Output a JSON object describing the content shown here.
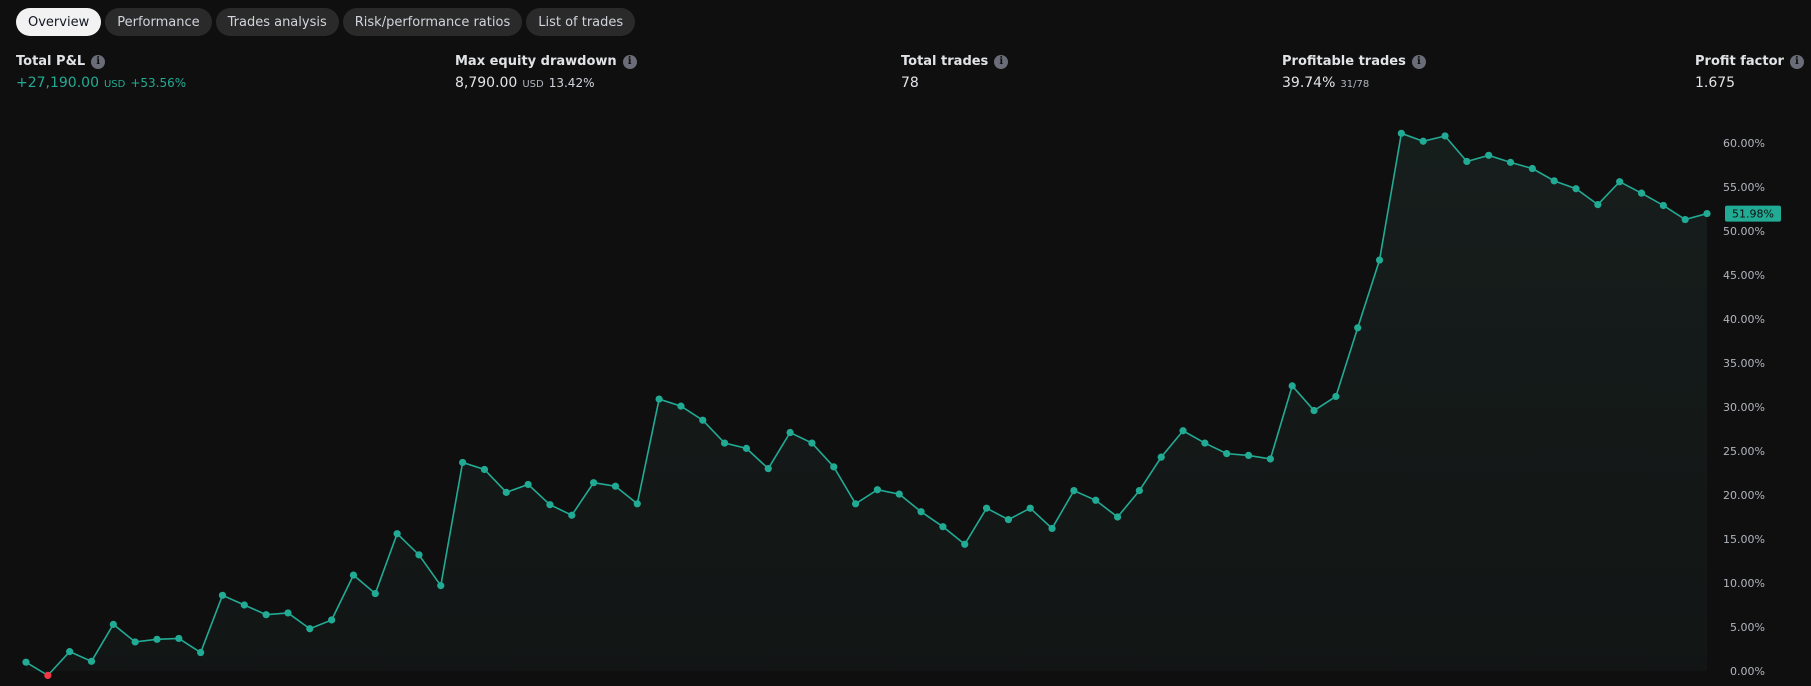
{
  "tabs": [
    {
      "label": "Overview",
      "active": true
    },
    {
      "label": "Performance",
      "active": false
    },
    {
      "label": "Trades analysis",
      "active": false
    },
    {
      "label": "Risk/performance ratios",
      "active": false
    },
    {
      "label": "List of trades",
      "active": false
    }
  ],
  "metrics": {
    "total_pnl": {
      "title": "Total P&L",
      "value": "+27,190.00",
      "unit": "USD",
      "percent": "+53.56%"
    },
    "max_drawdown": {
      "title": "Max equity drawdown",
      "value": "8,790.00",
      "unit": "USD",
      "percent": "13.42%"
    },
    "total_trades": {
      "title": "Total trades",
      "value": "78"
    },
    "profitable_trades": {
      "title": "Profitable trades",
      "value": "39.74%",
      "fraction": "31/78"
    },
    "profit_factor": {
      "title": "Profit factor",
      "value": "1.675"
    }
  },
  "icons": {
    "info": "info-icon"
  },
  "colors": {
    "line": "#22ab94",
    "negative_point": "#f23645",
    "background": "#0f0f0f",
    "label_bg": "#22ab94"
  },
  "chart_data": {
    "type": "line",
    "ylabel": "",
    "yunit": "%",
    "ylim": [
      0,
      62
    ],
    "yticks": [
      "0.00%",
      "5.00%",
      "10.00%",
      "15.00%",
      "20.00%",
      "25.00%",
      "30.00%",
      "35.00%",
      "40.00%",
      "45.00%",
      "50.00%",
      "55.00%",
      "60.00%"
    ],
    "current_value_label": "51.98%",
    "series": [
      {
        "values": [
          1.0,
          -0.5,
          2.2,
          1.1,
          5.3,
          3.3,
          3.6,
          3.7,
          2.1,
          8.6,
          7.5,
          6.4,
          6.6,
          4.8,
          5.8,
          10.9,
          8.8,
          15.6,
          13.2,
          9.7,
          23.7,
          22.9,
          20.3,
          21.2,
          18.9,
          17.7,
          21.4,
          21.0,
          19.0,
          30.9,
          30.1,
          28.5,
          25.9,
          25.3,
          23.0,
          27.1,
          25.9,
          23.2,
          19.0,
          20.6,
          20.1,
          18.1,
          16.4,
          14.4,
          18.5,
          17.2,
          18.5,
          16.2,
          20.5,
          19.4,
          17.5,
          20.5,
          24.3,
          27.3,
          25.9,
          24.7,
          24.5,
          24.1,
          32.4,
          29.6,
          31.2,
          39.0,
          46.7,
          61.1,
          60.2,
          60.8,
          57.9,
          58.6,
          57.8,
          57.1,
          55.7,
          54.8,
          53.0,
          55.6,
          54.3,
          52.9,
          51.3,
          51.98
        ]
      }
    ]
  }
}
